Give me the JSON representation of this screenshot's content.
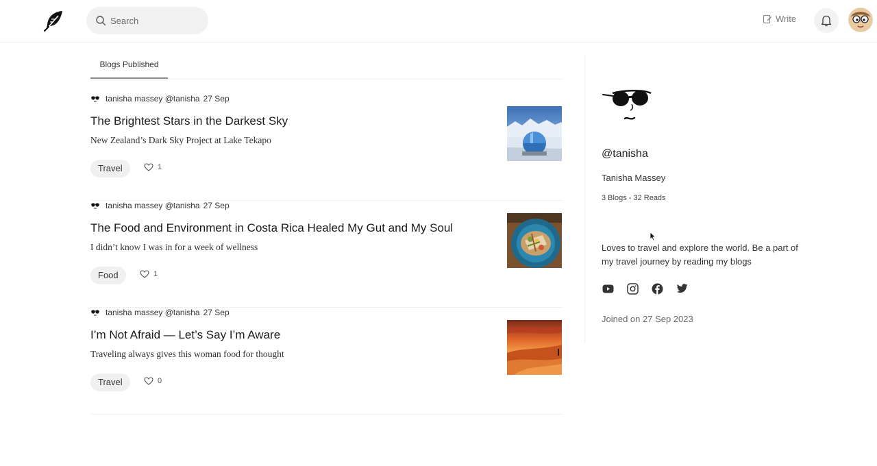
{
  "header": {
    "search_placeholder": "Search",
    "write_label": "Write"
  },
  "tabs": [
    {
      "label": "Blogs Published",
      "active": true
    }
  ],
  "articles": [
    {
      "author": "tanisha massey @tanisha",
      "date": "27 Sep",
      "title": "The Brightest Stars in the Darkest Sky",
      "subtitle": "New Zealand’s Dark Sky Project at Lake Tekapo",
      "tag": "Travel",
      "likes": "1"
    },
    {
      "author": "tanisha massey @tanisha",
      "date": "27 Sep",
      "title": "The Food and Environment in Costa Rica Healed My Gut and My Soul",
      "subtitle": "I didn’t know I was in for a week of wellness",
      "tag": "Food",
      "likes": "1"
    },
    {
      "author": "tanisha massey @tanisha",
      "date": "27 Sep",
      "title": "I’m Not Afraid — Let’s Say I’m Aware",
      "subtitle": "Traveling always gives this woman food for thought",
      "tag": "Travel",
      "likes": "0"
    }
  ],
  "profile": {
    "handle": "@tanisha",
    "name": "Tanisha Massey",
    "stats": "3 Blogs - 32 Reads",
    "bio": "Loves to travel and explore the world. Be a part of my travel journey by reading my blogs",
    "socials": [
      "youtube-icon",
      "instagram-icon",
      "facebook-icon",
      "twitter-icon"
    ],
    "joined": "Joined on 27 Sep 2023"
  },
  "colors": {
    "accent": "#1a1a1a",
    "tag_bg": "#f0f0f0",
    "muted": "#7a7a7a"
  }
}
